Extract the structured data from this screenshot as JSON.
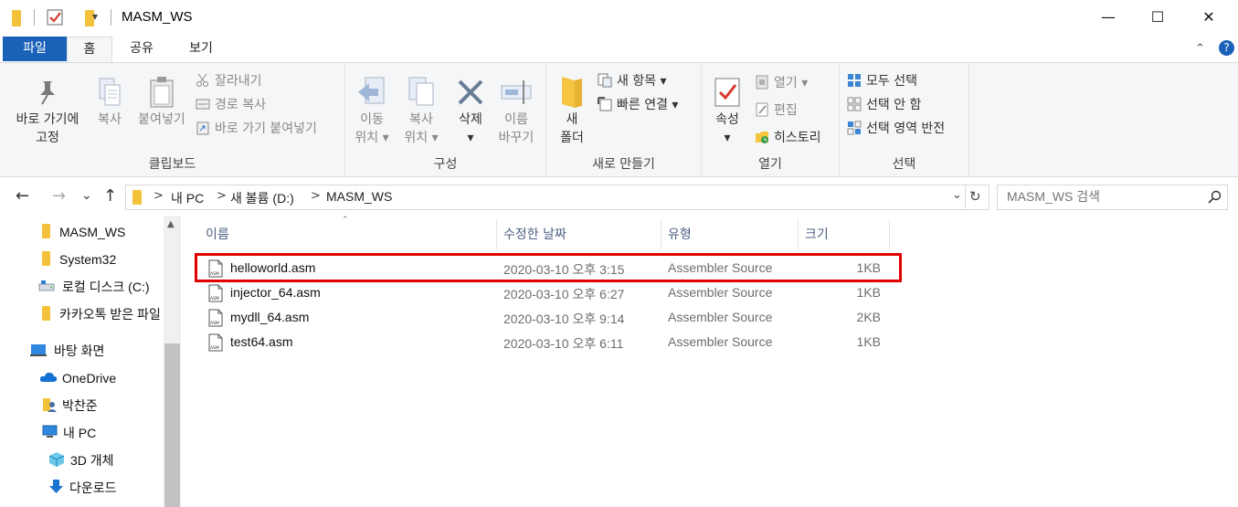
{
  "window": {
    "title": "MASM_WS",
    "minimize": "—",
    "maximize": "☐",
    "close": "✕",
    "quick_access_dropdown": "▾"
  },
  "tabs": {
    "file": "파일",
    "home": "홈",
    "share": "공유",
    "view": "보기",
    "collapse": "⌃",
    "help": "?"
  },
  "ribbon": {
    "clipboard": {
      "label": "클립보드",
      "pin": "바로 가기에\n고정",
      "copy": "복사",
      "paste": "붙여넣기",
      "cut": "잘라내기",
      "copy_path": "경로 복사",
      "paste_shortcut": "바로 가기 붙여넣기"
    },
    "organize": {
      "label": "구성",
      "move_to": "이동\n위치 ▾",
      "copy_to": "복사\n위치 ▾",
      "delete": "삭제\n▾",
      "rename": "이름\n바꾸기"
    },
    "new": {
      "label": "새로 만들기",
      "new_folder": "새\n폴더",
      "new_item": "새 항목 ▾",
      "easy_access": "빠른 연결 ▾"
    },
    "open": {
      "label": "열기",
      "properties": "속성\n▾",
      "open": "열기 ▾",
      "edit": "편집",
      "history": "히스토리"
    },
    "select": {
      "label": "선택",
      "select_all": "모두 선택",
      "select_none": "선택 안 함",
      "invert": "선택 영역 반전"
    }
  },
  "nav": {
    "back": "←",
    "forward": "→",
    "recent": "⌄",
    "up": "↑",
    "breadcrumb": [
      "내 PC",
      "새 볼륨 (D:)",
      "MASM_WS"
    ],
    "search_placeholder": "MASM_WS 검색"
  },
  "sidebar": {
    "items": [
      {
        "label": "MASM_WS",
        "icon": "folder-icon"
      },
      {
        "label": "System32",
        "icon": "folder-icon"
      },
      {
        "label": "로컬 디스크 (C:)",
        "icon": "drive-icon"
      },
      {
        "label": "카카오톡 받은 파일",
        "icon": "folder-icon"
      },
      {
        "label": "바탕 화면",
        "icon": "desktop-icon"
      },
      {
        "label": "OneDrive",
        "icon": "cloud-icon"
      },
      {
        "label": "박찬준",
        "icon": "user-icon"
      },
      {
        "label": "내 PC",
        "icon": "pc-icon"
      },
      {
        "label": "3D 개체",
        "icon": "cube-icon"
      },
      {
        "label": "다운로드",
        "icon": "download-icon"
      }
    ]
  },
  "filelist": {
    "columns": {
      "name": "이름",
      "date": "수정한 날짜",
      "type": "유형",
      "size": "크기"
    },
    "rows": [
      {
        "name": "helloworld.asm",
        "date": "2020-03-10 오후 3:15",
        "type": "Assembler Source",
        "size": "1KB"
      },
      {
        "name": "injector_64.asm",
        "date": "2020-03-10 오후 6:27",
        "type": "Assembler Source",
        "size": "1KB"
      },
      {
        "name": "mydll_64.asm",
        "date": "2020-03-10 오후 9:14",
        "type": "Assembler Source",
        "size": "2KB"
      },
      {
        "name": "test64.asm",
        "date": "2020-03-10 오후 6:11",
        "type": "Assembler Source",
        "size": "1KB"
      }
    ],
    "file_icon_label": "ASM"
  },
  "colors": {
    "file_tab": "#1a62b8",
    "highlight": "#e10000",
    "header_text": "#4d6082"
  }
}
